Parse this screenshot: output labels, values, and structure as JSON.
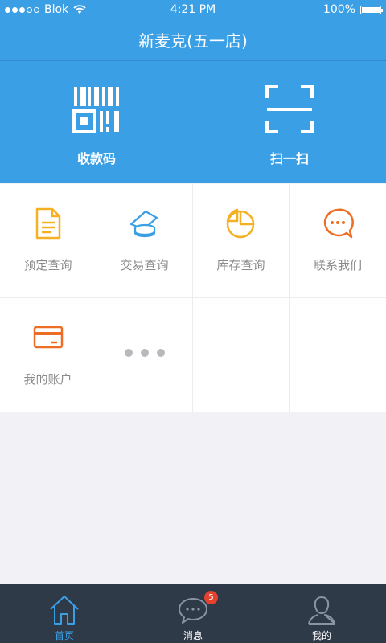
{
  "status_bar": {
    "carrier": "Blok",
    "time": "4:21 PM",
    "battery": "100%"
  },
  "nav": {
    "title": "新麦克(五一店)"
  },
  "hero": {
    "actions": [
      {
        "label": "收款码",
        "icon": "qr-code-icon"
      },
      {
        "label": "扫一扫",
        "icon": "scan-icon"
      }
    ]
  },
  "grid": {
    "items": [
      {
        "label": "预定查询",
        "icon": "document-icon",
        "color": "#f6b024"
      },
      {
        "label": "交易查询",
        "icon": "coins-icon",
        "color": "#3b9fe6"
      },
      {
        "label": "库存查询",
        "icon": "pie-chart-icon",
        "color": "#f6b024"
      },
      {
        "label": "联系我们",
        "icon": "chat-icon",
        "color": "#ee6d24"
      },
      {
        "label": "我的账户",
        "icon": "card-icon",
        "color": "#ee6d24"
      }
    ],
    "more_icon": "more-dots-icon"
  },
  "tabs": [
    {
      "label": "首页",
      "icon": "home-icon",
      "active": true
    },
    {
      "label": "消息",
      "icon": "message-icon",
      "badge": "5"
    },
    {
      "label": "我的",
      "icon": "user-icon"
    }
  ],
  "colors": {
    "primary": "#3b9fe6",
    "tab_bg": "#2f3a49",
    "badge": "#e5412f"
  }
}
